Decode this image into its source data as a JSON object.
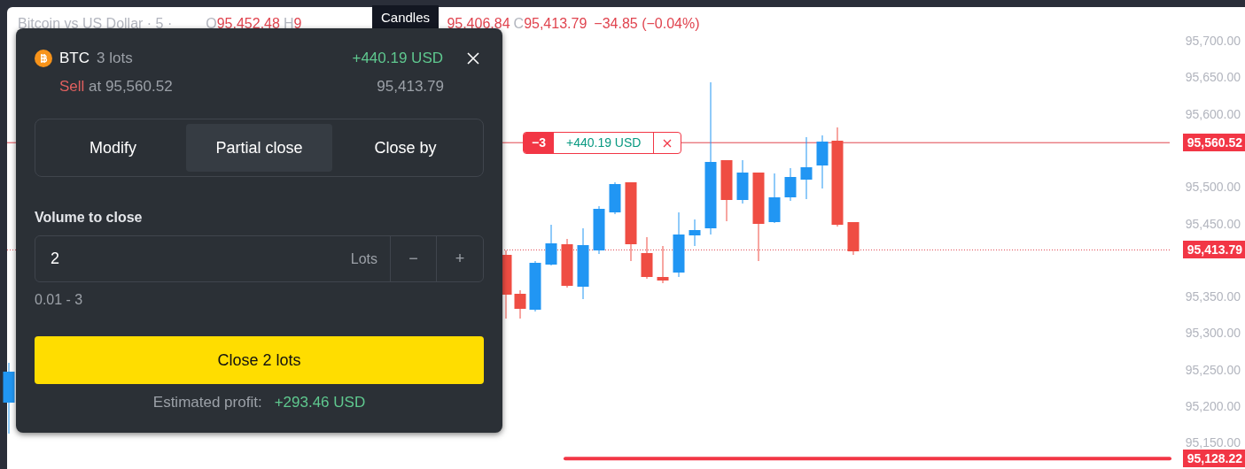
{
  "chart": {
    "legend": {
      "title": "Bitcoin vs US Dollar · 5 ·",
      "open": {
        "label": "O",
        "value": "95,452.48"
      },
      "high": {
        "label": "H",
        "value": "9"
      },
      "low_value": "95,406.84",
      "close": {
        "label": "C",
        "value": "95,413.79"
      },
      "change": "−34.85 (−0.04%)"
    },
    "tooltip": "Candles",
    "y_axis": [
      "95,700.00",
      "95,650.00",
      "95,600.00",
      "95,500.00",
      "95,450.00",
      "95,350.00",
      "95,300.00",
      "95,250.00",
      "95,200.00",
      "95,150.00"
    ],
    "price_badges": [
      {
        "kind": "position",
        "text": "95,560.52"
      },
      {
        "kind": "last_price",
        "text": "95,413.79"
      },
      {
        "kind": "level",
        "text": "95,128.22"
      }
    ],
    "position_tag": {
      "quantity": "−3",
      "pnl": "+440.19 USD"
    }
  },
  "panel": {
    "symbol": "BTC",
    "volume": "3 lots",
    "pnl": "+440.19 USD",
    "side": "Sell",
    "entry": "at 95,560.52",
    "current_price": "95,413.79",
    "tabs": [
      {
        "label": "Modify",
        "selected": false
      },
      {
        "label": "Partial close",
        "selected": true
      },
      {
        "label": "Close by",
        "selected": false
      }
    ],
    "volume_field": {
      "label": "Volume to close",
      "value": "2",
      "unit": "Lots",
      "decrement": "−",
      "increment": "+",
      "range": "0.01 - 3"
    },
    "close_button": "Close 2 lots",
    "estimate": {
      "label": "Estimated profit:",
      "value": "+293.46 USD"
    }
  }
}
